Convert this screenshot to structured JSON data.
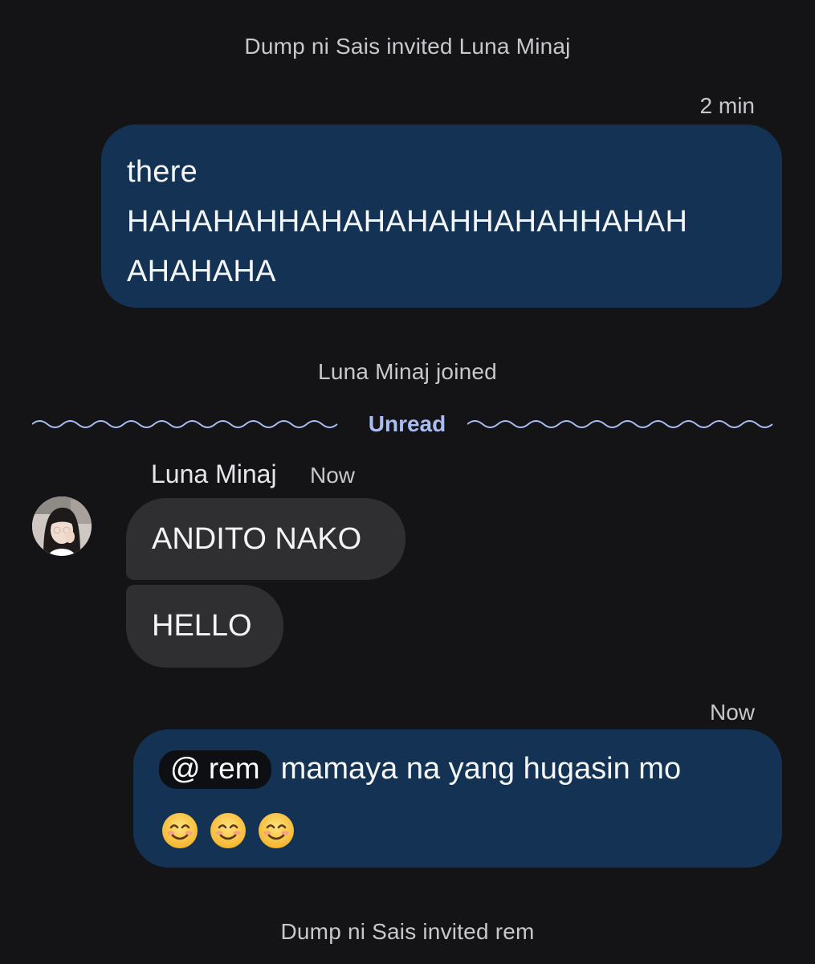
{
  "events": {
    "invite_luna": "Dump ni Sais invited Luna Minaj",
    "luna_joined": "Luna Minaj joined",
    "invite_rem": "Dump ni Sais invited rem"
  },
  "message1": {
    "time": "2 min",
    "lines": [
      "there",
      "HAHAHAHHAHAHAHAHHAHAHHAHAH",
      "AHAHAHA"
    ]
  },
  "divider": {
    "label": "Unread"
  },
  "incoming": {
    "sender": "Luna Minaj",
    "time": "Now",
    "messages": [
      "ANDITO NAKO",
      "HELLO"
    ]
  },
  "message2": {
    "time": "Now",
    "mention": "@ rem",
    "text": "mamaya na yang hugasin mo",
    "emojis": [
      "smiling-face-icon",
      "smiling-face-icon",
      "smiling-face-icon"
    ]
  },
  "colors": {
    "background": "#141416",
    "outgoing_bubble": "#143354",
    "incoming_bubble": "#2f2f31",
    "unread_accent": "#a9bdf2"
  }
}
